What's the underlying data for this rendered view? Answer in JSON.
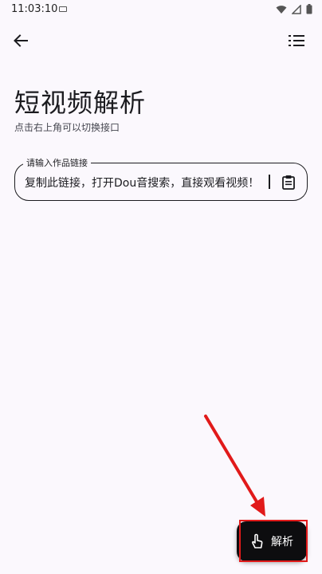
{
  "status": {
    "time": "11:03:10"
  },
  "header": {
    "back_icon": "arrow-back-icon",
    "menu_icon": "list-menu-icon"
  },
  "page": {
    "title": "短视频解析",
    "subtitle": "点击右上角可以切换接口"
  },
  "input": {
    "label": "请输入作品链接",
    "value": "复制此链接，打开Dou音搜索，直接观看视频！",
    "paste_icon": "clipboard-icon"
  },
  "fab": {
    "label": "解析",
    "icon": "hand-pointer-icon"
  },
  "colors": {
    "annotation": "#e11a1a",
    "fab_bg": "#0d0d0f",
    "background": "#fbf8fd"
  }
}
